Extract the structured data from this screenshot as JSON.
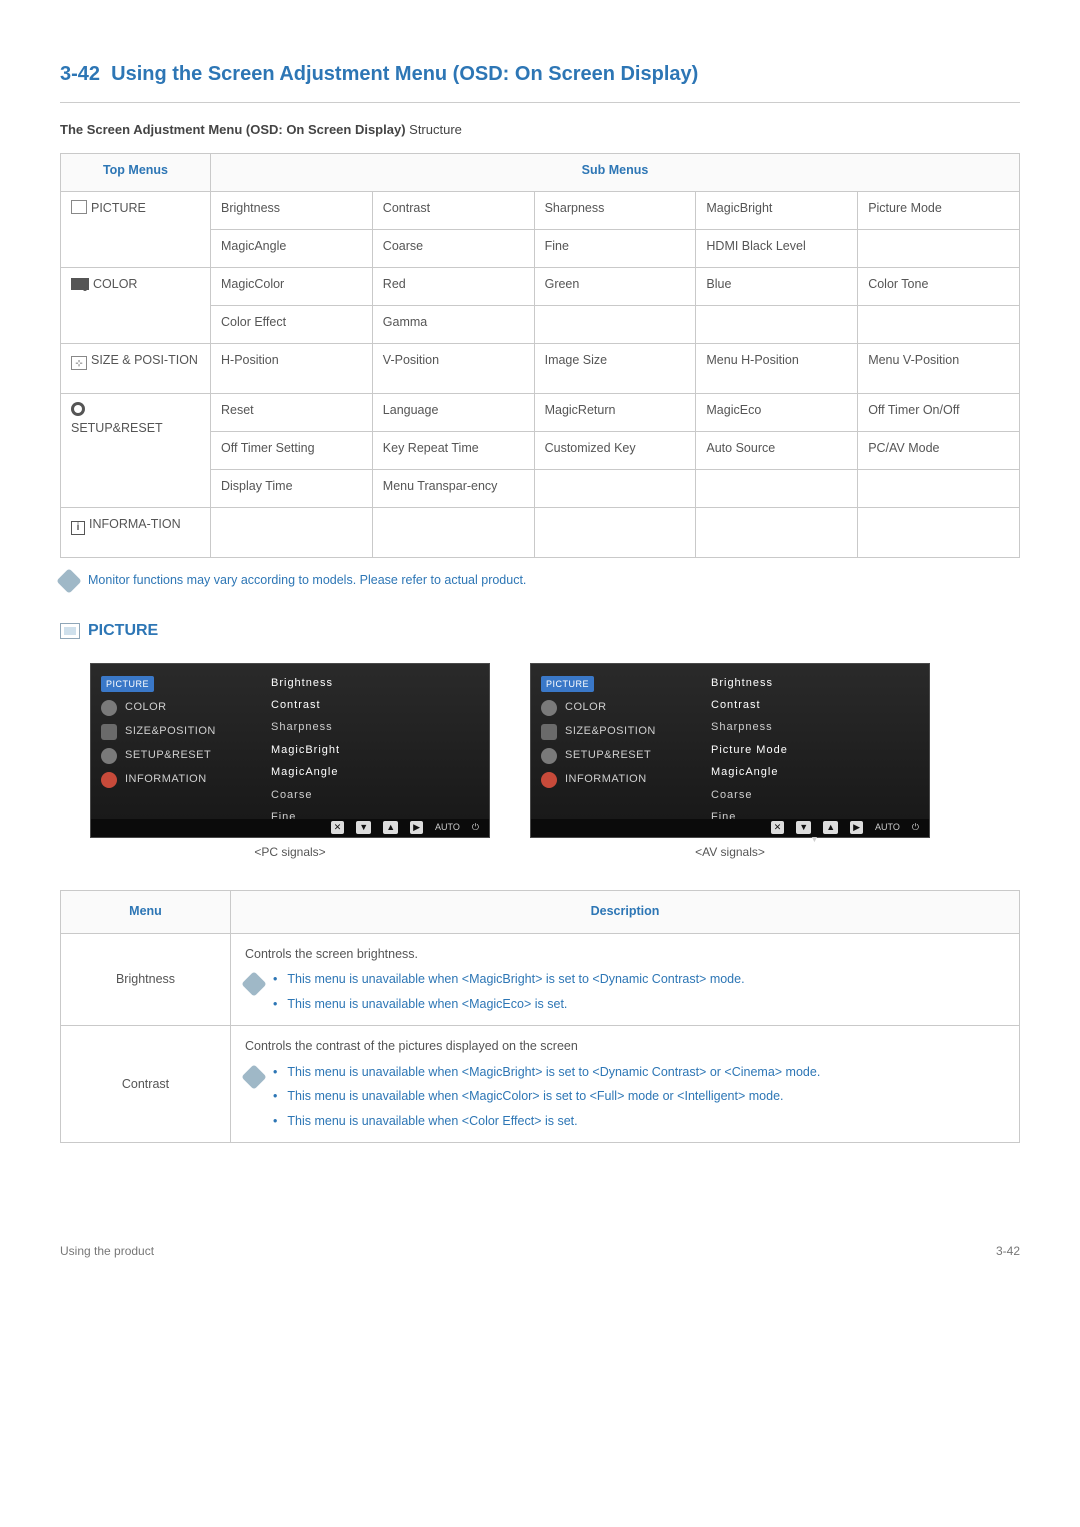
{
  "page": {
    "section_number": "3-42",
    "title": "Using the Screen Adjustment Menu (OSD: On Screen Display)",
    "subtitle_bold": "The Screen Adjustment Menu (OSD: On Screen Display)",
    "subtitle_tail": " Structure"
  },
  "table_headers": {
    "top": "Top Menus",
    "sub": "Sub Menus"
  },
  "top_menus": {
    "picture": "PICTURE",
    "color": "COLOR",
    "sizepos": "SIZE & POSI-TION",
    "setup": "SETUP&RESET",
    "info": "INFORMA-TION"
  },
  "rows": {
    "picture1": [
      "Brightness",
      "Contrast",
      "Sharpness",
      "MagicBright",
      "Picture Mode"
    ],
    "picture2": [
      "MagicAngle",
      "Coarse",
      "Fine",
      "HDMI Black Level",
      ""
    ],
    "color1": [
      "MagicColor",
      "Red",
      "Green",
      "Blue",
      "Color Tone"
    ],
    "color2": [
      "Color Effect",
      "Gamma",
      "",
      "",
      ""
    ],
    "sizepos1": [
      "H-Position",
      "V-Position",
      "Image Size",
      "Menu H-Position",
      "Menu V-Position"
    ],
    "setup1": [
      "Reset",
      "Language",
      "MagicReturn",
      "MagicEco",
      "Off Timer On/Off"
    ],
    "setup2": [
      "Off Timer Setting",
      "Key Repeat Time",
      "Customized Key",
      "Auto Source",
      "PC/AV Mode"
    ],
    "setup3": [
      "Display Time",
      "Menu Transpar-ency",
      "",
      "",
      ""
    ],
    "info1": [
      "",
      "",
      "",
      "",
      ""
    ]
  },
  "top_note": "Monitor functions may vary according to models. Please refer to actual product.",
  "section_picture": "PICTURE",
  "osd": {
    "nav": {
      "picture": "PICTURE",
      "color": "COLOR",
      "sizepos": "SIZE&POSITION",
      "setup": "SETUP&RESET",
      "info": "INFORMATION"
    },
    "pc": {
      "opts": [
        "Brightness",
        "Contrast",
        "Sharpness",
        "MagicBright",
        "MagicAngle",
        "Coarse",
        "Fine"
      ],
      "caption": "<PC signals>"
    },
    "av": {
      "opts": [
        "Brightness",
        "Contrast",
        "Sharpness",
        "Picture Mode",
        "MagicAngle",
        "Coarse",
        "Fine"
      ],
      "caption": "<AV signals>"
    },
    "bottom": {
      "auto": "AUTO"
    }
  },
  "desc_headers": {
    "menu": "Menu",
    "desc": "Description"
  },
  "desc": {
    "brightness": {
      "name": "Brightness",
      "line": "Controls the screen brightness.",
      "notes": [
        "This menu is unavailable when <MagicBright> is set to <Dynamic Contrast> mode.",
        "This menu is unavailable when <MagicEco> is set."
      ]
    },
    "contrast": {
      "name": "Contrast",
      "line": "Controls the contrast of the pictures displayed on the screen",
      "notes": [
        "This menu is unavailable when <MagicBright> is set to <Dynamic Contrast> or <Cinema> mode.",
        "This menu is unavailable when <MagicColor> is set to <Full> mode or <Intelligent> mode.",
        "This menu is unavailable when <Color Effect> is set."
      ]
    }
  },
  "footer": {
    "left": "Using the product",
    "right": "3-42"
  }
}
